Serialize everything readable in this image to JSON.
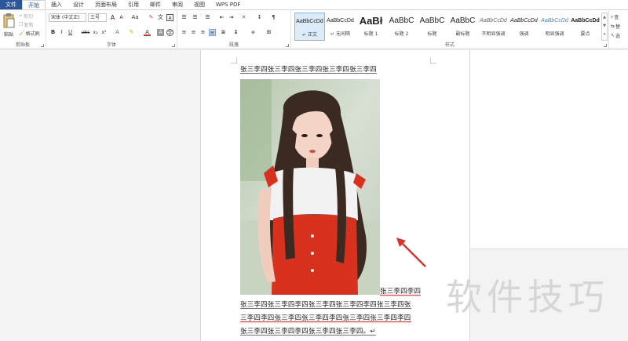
{
  "tabs": [
    "文件",
    "开始",
    "插入",
    "设计",
    "页面布局",
    "引用",
    "邮件",
    "审阅",
    "视图",
    "WPS PDF"
  ],
  "clipboard": {
    "paste": "粘贴",
    "cut": "剪切",
    "copy": "复制",
    "format_painter": "格式刷",
    "label": "剪贴板"
  },
  "font": {
    "name": "宋体 (中文正)",
    "size": "三号",
    "label": "字体",
    "grow": "A",
    "shrink": "A",
    "case": "Aa",
    "bold": "B",
    "italic": "I",
    "underline": "U",
    "strike": "abc",
    "sub": "x₂",
    "sup": "x²",
    "color_a": "A"
  },
  "paragraph": {
    "label": "段落"
  },
  "styles": {
    "label": "样式",
    "items": [
      {
        "sample": "AaBbCcDd",
        "name": "↵ 正文"
      },
      {
        "sample": "AaBbCcDd",
        "name": "↵ 无间隔"
      },
      {
        "sample": "AaBł",
        "name": "标题 1"
      },
      {
        "sample": "AaBbC",
        "name": "标题 2"
      },
      {
        "sample": "AaBbC",
        "name": "标题"
      },
      {
        "sample": "AaBbC",
        "name": "副标题"
      },
      {
        "sample": "AaBbCcDd",
        "name": "不明显强调"
      },
      {
        "sample": "AaBbCcDd",
        "name": "强调"
      },
      {
        "sample": "AaBbCcDd",
        "name": "明显强调"
      },
      {
        "sample": "AaBbCcDd",
        "name": "要点"
      }
    ]
  },
  "editing": {
    "find": "查",
    "replace": "替",
    "select": "选"
  },
  "document": {
    "line1": "张三李四张三李四张三李四张三李四张三李四",
    "after_image": "张三李四李四",
    "line3": "张三李四张三李四李四张三李四张三李四李四张三李四张",
    "line4": "三李四李四张三李四张三李四李四张三李四张三李四李四",
    "line5": "张三李四张三李四李四张三李四张三李四。↵"
  },
  "watermark": "软件技巧",
  "colors": {
    "accent": "#2b579a",
    "arrow": "#d9332a",
    "dress": "#d8321e"
  }
}
